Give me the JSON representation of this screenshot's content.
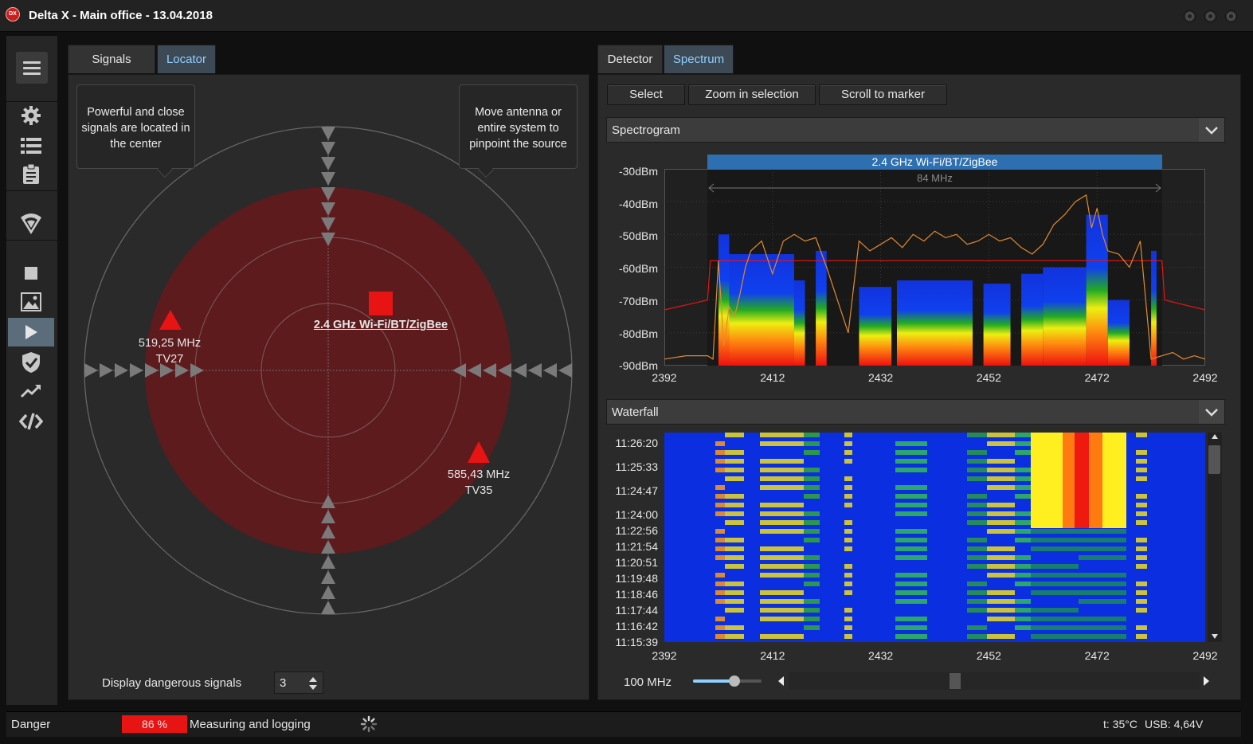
{
  "window": {
    "title": "Delta X - Main office - 13.04.2018",
    "logo_text": "DX"
  },
  "left_panel": {
    "tabs": [
      {
        "label": "Signals",
        "active": false
      },
      {
        "label": "Locator",
        "active": true
      }
    ],
    "callout_left": "Powerful and close signals are located in the center",
    "callout_right": "Move antenna or entire system to pinpoint the source",
    "signals": [
      {
        "freq": "519,25 MHz",
        "name": "TV27",
        "marker": "triangle",
        "color": "#e81414"
      },
      {
        "freq": "2.4 GHz Wi-Fi/BT/ZigBee",
        "name": "",
        "marker": "square",
        "color": "#e81414"
      },
      {
        "freq": "585,43 MHz",
        "name": "TV35",
        "marker": "triangle",
        "color": "#e81414"
      }
    ],
    "display_dangerous_label": "Display dangerous signals",
    "display_dangerous_value": "3"
  },
  "right_panel": {
    "tabs": [
      {
        "label": "Detector",
        "active": false
      },
      {
        "label": "Spectrum",
        "active": true
      }
    ],
    "buttons": {
      "select": "Select",
      "zoom": "Zoom in selection",
      "scroll": "Scroll to marker"
    },
    "spectrogram": {
      "title": "Spectrogram",
      "band_label": "2.4 GHz Wi-Fi/BT/ZigBee",
      "band_width": "84 MHz",
      "y_ticks": [
        "-30dBm",
        "-40dBm",
        "-50dBm",
        "-60dBm",
        "-70dBm",
        "-80dBm",
        "-90dBm"
      ],
      "x_ticks": [
        "2392",
        "2412",
        "2432",
        "2452",
        "2472",
        "2492"
      ]
    },
    "waterfall": {
      "title": "Waterfall",
      "times": [
        "11:26:20",
        "11:25:33",
        "11:24:47",
        "11:24:00",
        "11:22:56",
        "11:21:54",
        "11:20:51",
        "11:19:48",
        "11:18:46",
        "11:17:44",
        "11:16:42",
        "11:15:39"
      ],
      "x_ticks": [
        "2392",
        "2412",
        "2432",
        "2452",
        "2472",
        "2492"
      ],
      "span_label": "100 MHz",
      "span_slider": 0.6
    }
  },
  "status": {
    "danger_label": "Danger",
    "danger_value": "86 %",
    "activity": "Measuring and logging",
    "temp": "t: 35°C",
    "usb": "USB: 4,64V"
  },
  "colors": {
    "accent": "#8fd0ff",
    "danger": "#e81414",
    "band": "#2d6fb0"
  },
  "chart_data": {
    "type": "line",
    "title": "Spectrogram",
    "xlabel": "",
    "ylabel": "",
    "xlim": [
      2392,
      2492
    ],
    "ylim": [
      -90,
      -30
    ],
    "series": [
      {
        "name": "",
        "x": [
          2392,
          2396,
          2400,
          2401,
          2402,
          2403,
          2404,
          2405,
          2406,
          2407,
          2408,
          2410,
          2412,
          2414,
          2416,
          2418,
          2420,
          2422,
          2424,
          2426,
          2428,
          2430,
          2432,
          2434,
          2436,
          2438,
          2440,
          2442,
          2444,
          2446,
          2448,
          2450,
          2452,
          2454,
          2456,
          2458,
          2460,
          2462,
          2464,
          2466,
          2468,
          2470,
          2471,
          2472,
          2473,
          2474,
          2476,
          2478,
          2480,
          2482,
          2484,
          2486,
          2488,
          2490,
          2492
        ],
        "y": [
          -88,
          -87,
          -87,
          -88,
          -58,
          -84,
          -72,
          -75,
          -68,
          -60,
          -55,
          -52,
          -62,
          -52,
          -50,
          -52,
          -51,
          -60,
          -70,
          -80,
          -52,
          -55,
          -53,
          -51,
          -54,
          -50,
          -52,
          -49,
          -51,
          -50,
          -53,
          -52,
          -50,
          -52,
          -51,
          -54,
          -56,
          -53,
          -47,
          -44,
          -40,
          -38,
          -48,
          -42,
          -50,
          -55,
          -56,
          -60,
          -52,
          -88,
          -87,
          -86,
          -88,
          -87,
          -88
        ]
      }
    ]
  }
}
